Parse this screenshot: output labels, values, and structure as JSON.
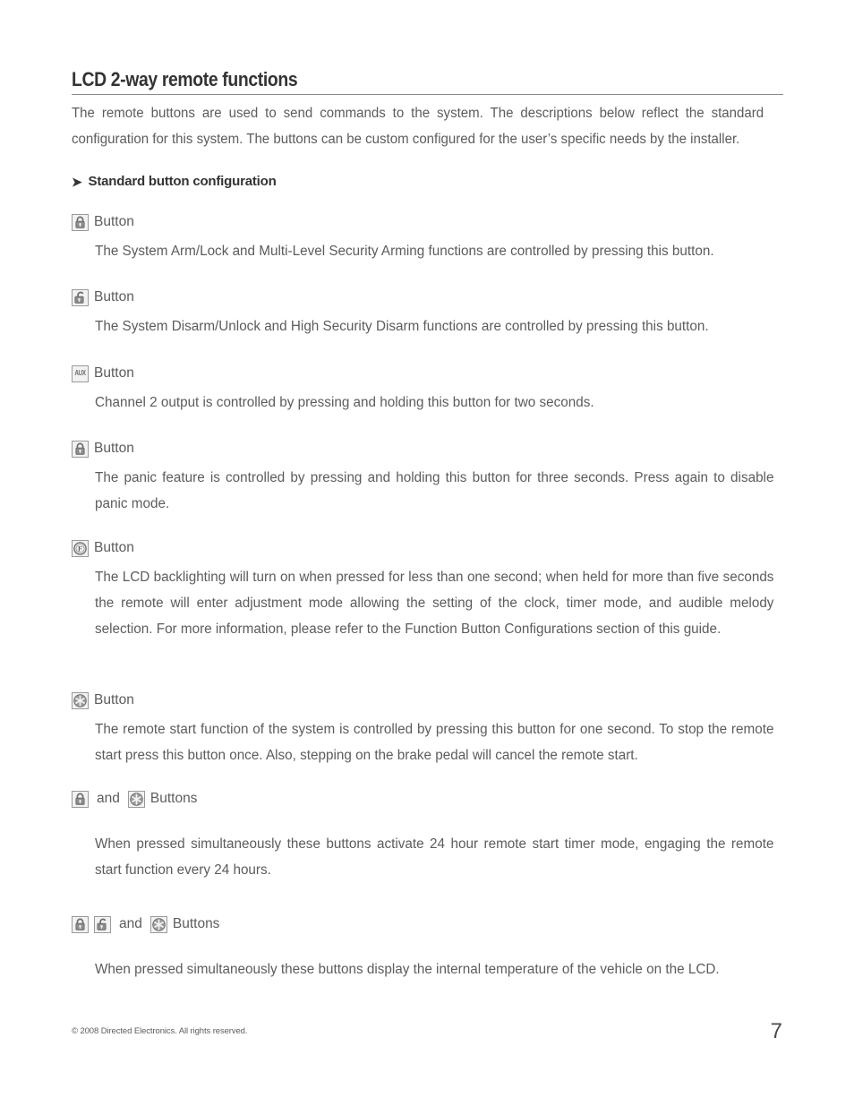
{
  "page": {
    "title": "LCD 2-way remote functions",
    "intro": "The remote buttons are used to send commands to the system. The descriptions below reflect the standard configuration for this system. The buttons can be custom configured for the user’s specific needs by the installer.",
    "section_heading": "Standard button configuration",
    "arrow_bullet": "➤"
  },
  "icons": {
    "lock": "padlock-closed-icon",
    "unlock": "padlock-open-icon",
    "aux": "aux-text-icon",
    "aux_label": "AUX",
    "function": "circled-f-icon",
    "function_label": "F",
    "star": "starburst-icon"
  },
  "entries": [
    {
      "id": "arm-lock",
      "icons": [
        "lock"
      ],
      "label": "Button",
      "body": "The System Arm/Lock and Multi-Level Security Arming functions are controlled by pressing this button."
    },
    {
      "id": "disarm-unlock",
      "icons": [
        "unlock"
      ],
      "label": "Button",
      "body": "The System Disarm/Unlock and High Security Disarm functions are controlled by pressing this button."
    },
    {
      "id": "channel-2",
      "icons": [
        "aux"
      ],
      "label": "Button",
      "body": "Channel 2 output is controlled by pressing and holding this button for two seconds."
    },
    {
      "id": "panic",
      "icons": [
        "lock"
      ],
      "label": "Button",
      "body": "The panic feature is controlled by pressing and holding this button for three seconds. Press again to disable panic mode."
    },
    {
      "id": "backlight-function",
      "icons": [
        "function"
      ],
      "label": "Button",
      "body": "The LCD backlighting will turn on when pressed for less than one second; when held for more than five seconds the remote will enter adjustment mode allowing the setting of the clock, timer mode, and audible melody selection. For more information, please refer to the Function Button Configurations section of this guide."
    },
    {
      "id": "remote-start",
      "icons": [
        "star"
      ],
      "label": "Button",
      "body": "The remote start function of the system is controlled by pressing this button for one second. To stop the remote start press this button once. Also, stepping on the brake pedal will cancel the remote start."
    },
    {
      "id": "timer-mode-combo",
      "icons": [
        "lock",
        "star"
      ],
      "joiner": "and",
      "label": "Buttons",
      "body": "When pressed simultaneously these buttons activate 24 hour remote start timer mode, engaging the remote start function every 24 hours."
    },
    {
      "id": "temperature-combo",
      "icons": [
        "lock",
        "unlock",
        "star"
      ],
      "joiner": "and",
      "label": "Buttons",
      "body": "When pressed simultaneously these buttons display the internal temperature of the vehicle on the LCD."
    }
  ],
  "footer": {
    "copyright": "© 2008 Directed Electronics. All rights reserved.",
    "page_number": "7"
  }
}
